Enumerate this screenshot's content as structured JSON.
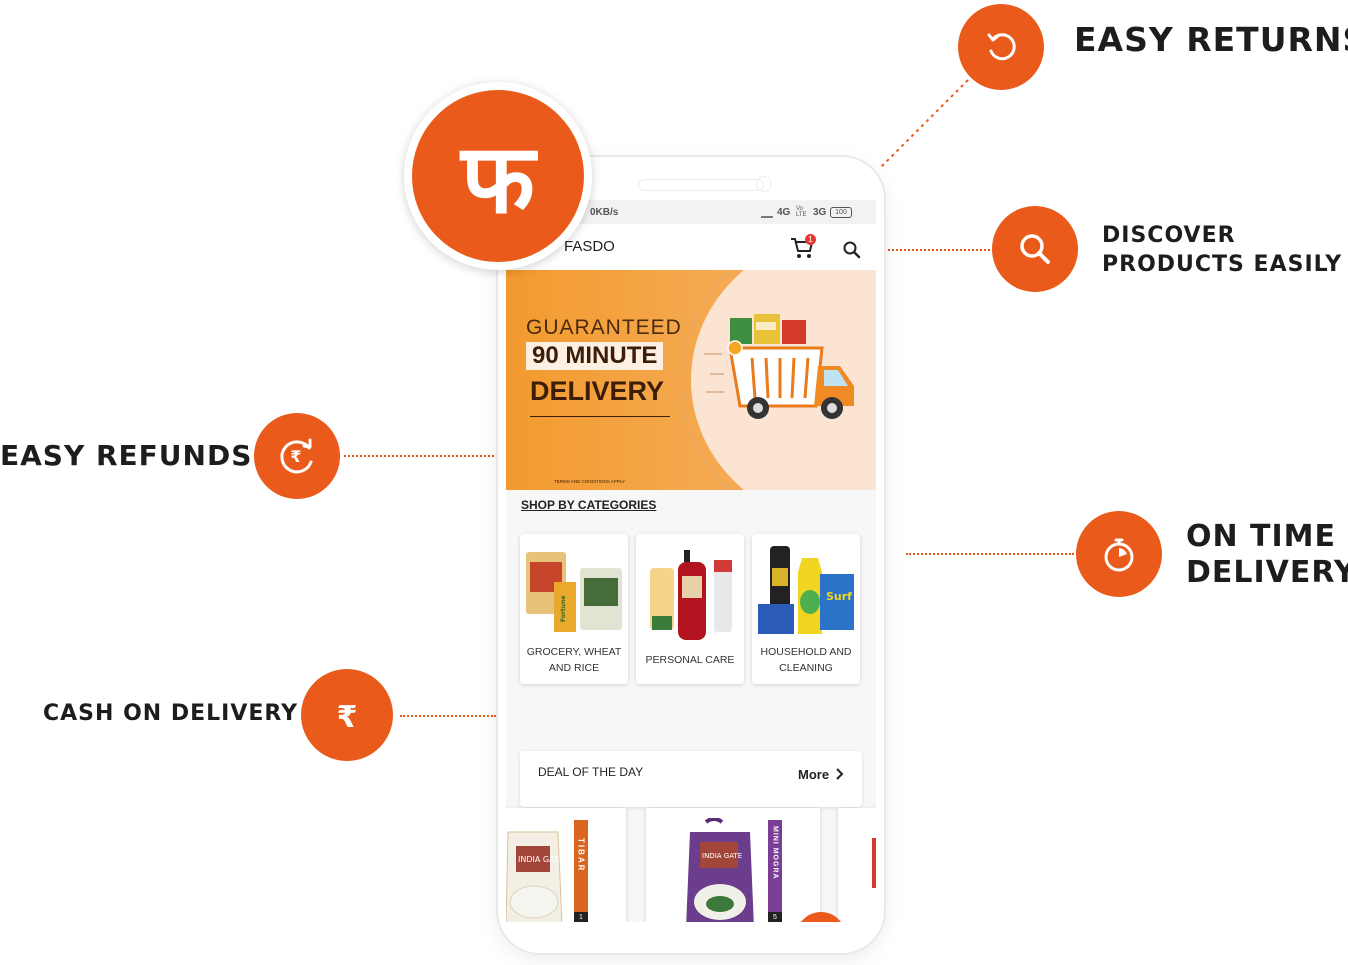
{
  "brand": {
    "logo_glyph": "फ",
    "app_name": "FASDO",
    "accent_color": "#ea5a1a"
  },
  "features": {
    "easy_returns": {
      "label": "EASY RETURNS",
      "icon": "return-icon"
    },
    "discover": {
      "line1": "DISCOVER",
      "line2": "PRODUCTS EASILY",
      "icon": "search-icon"
    },
    "on_time": {
      "line1": "ON TIME",
      "line2": "DELIVERY",
      "icon": "stopwatch-icon"
    },
    "easy_refunds": {
      "label": "EASY REFUNDS",
      "icon": "rupee-refresh-icon"
    },
    "cash_on_delivery": {
      "label": "CASH ON DELIVERY",
      "icon": "rupee-icon"
    }
  },
  "status_bar": {
    "speed": "0KB/s",
    "network": "4G",
    "volte": "Vo LTE",
    "network2": "3G",
    "battery": "100"
  },
  "app_bar": {
    "cart_count": "1"
  },
  "banner": {
    "line1": "GUARANTEED",
    "line2": "90 MINUTE",
    "line3": "DELIVERY",
    "fine_print": "TERMS AND CONDITIONS APPLY"
  },
  "categories": {
    "heading": "SHOP BY CATEGORIES",
    "items": [
      {
        "label_line1": "GROCERY, WHEAT",
        "label_line2": "AND RICE"
      },
      {
        "label_line1": "PERSONAL CARE",
        "label_line2": ""
      },
      {
        "label_line1": "HOUSEHOLD AND",
        "label_line2": "CLEANING"
      }
    ]
  },
  "deal": {
    "heading": "DEAL OF THE DAY",
    "more_label": "More",
    "products": [
      {
        "brand": "INDIA GATE",
        "side_label": "TIBAR",
        "pack_size": "1"
      },
      {
        "brand": "INDIA GATE",
        "side_label": "MINI MOGRA",
        "pack_size": "5"
      }
    ]
  }
}
